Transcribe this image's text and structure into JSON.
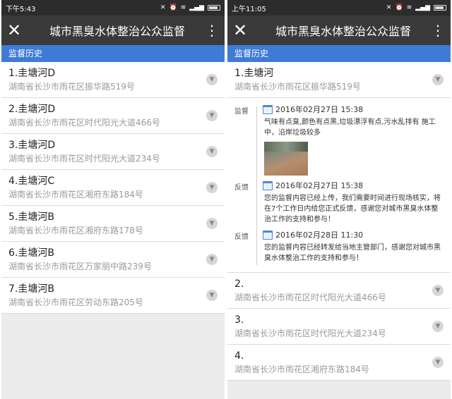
{
  "app": {
    "title": "城市黑臭水体整治公众监督"
  },
  "left": {
    "status_time": "下午5:43",
    "section": "监督历史",
    "items": [
      {
        "title": "1.圭塘河D",
        "addr": "湖南省长沙市雨花区振华路519号"
      },
      {
        "title": "2.圭塘河D",
        "addr": "湖南省长沙市雨花区时代阳光大道466号"
      },
      {
        "title": "3.圭塘河D",
        "addr": "湖南省长沙市雨花区时代阳光大道234号"
      },
      {
        "title": "4.圭塘河C",
        "addr": "湖南省长沙市雨花区湘府东路184号"
      },
      {
        "title": "5.圭塘河B",
        "addr": "湖南省长沙市雨花区湘府东路178号"
      },
      {
        "title": "6.圭塘河B",
        "addr": "湖南省长沙市雨花区万家丽中路239号"
      },
      {
        "title": "7.圭塘河B",
        "addr": "湖南省长沙市雨花区劳动东路205号"
      }
    ]
  },
  "right": {
    "status_time": "上午11:05",
    "section": "监督历史",
    "expanded": {
      "title": "1.圭塘河",
      "addr": "湖南省长沙市雨花区振华路519号"
    },
    "timeline": [
      {
        "label": "监督",
        "time": "2016年02月27日 15:38",
        "text": "气味有点臭,颜色有点黑,垃圾漂浮有点,污水乱排有 施工中，沿岸垃圾较多"
      },
      {
        "label": "反馈",
        "time": "2016年02月27日 15:38",
        "text": "您的监督内容已经上传，我们需要时间进行现场核实，将在7个工作日内给您正式反馈，感谢您对城市黑臭水体整治工作的支持和参与！"
      },
      {
        "label": "反馈",
        "time": "2016年02月28日 11:30",
        "text": "您的监督内容已经转发给当地主管部门，感谢您对城市黑臭水体整治工作的支持和参与！"
      }
    ],
    "items": [
      {
        "title": "2.",
        "addr": "湖南省长沙市雨花区时代阳光大道466号"
      },
      {
        "title": "3.",
        "addr": "湖南省长沙市雨花区时代阳光大道234号"
      },
      {
        "title": "4.",
        "addr": "湖南省长沙市雨花区湘府东路184号"
      }
    ]
  }
}
